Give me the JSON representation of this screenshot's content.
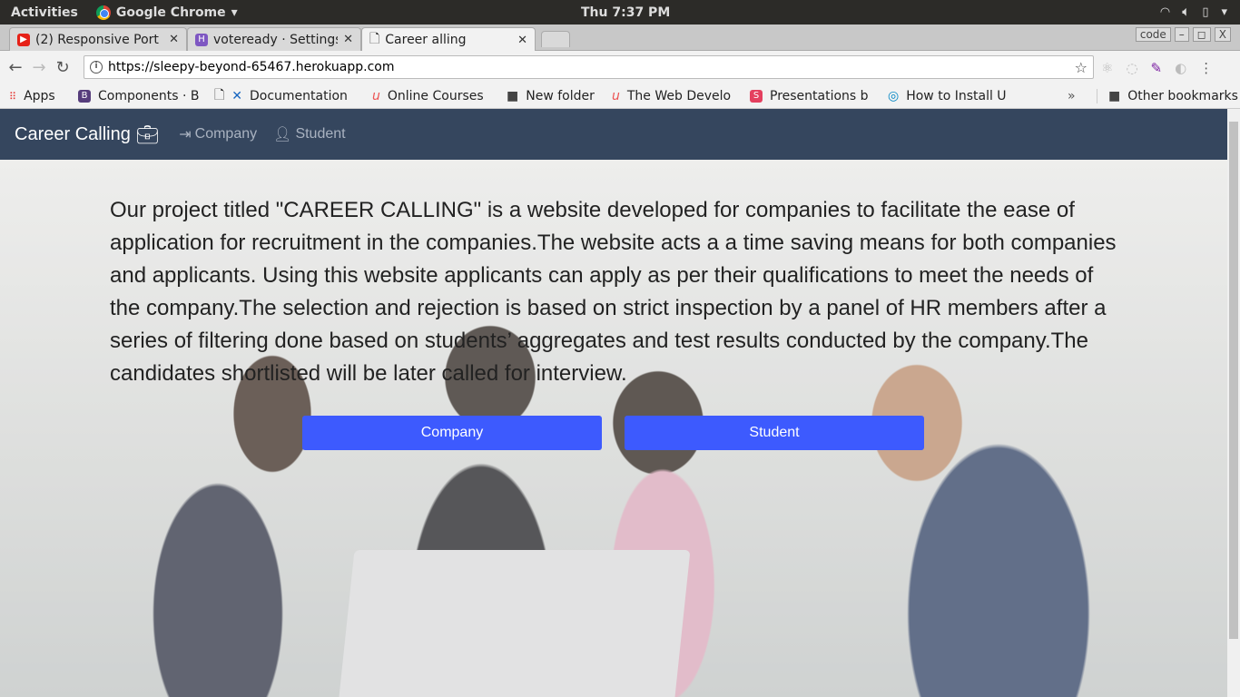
{
  "os": {
    "activities": "Activities",
    "app": "Google Chrome",
    "clock": "Thu  7:37 PM"
  },
  "tabs": [
    {
      "title": "(2) Responsive Port",
      "color": "#e62117"
    },
    {
      "title": "voteready · Settings",
      "color": "#7e57c2"
    },
    {
      "title": "Career alling",
      "color": "#ffffff"
    }
  ],
  "window": {
    "profile": "code",
    "min": "–",
    "max": "◻",
    "close": "X"
  },
  "url": "https://sleepy-beyond-65467.herokuapp.com",
  "bookmarks": [
    {
      "label": "Apps"
    },
    {
      "label": "Components · B"
    },
    {
      "label": "Documentation"
    },
    {
      "label": "Online Courses"
    },
    {
      "label": "New folder"
    },
    {
      "label": "The Web Develo"
    },
    {
      "label": "Presentations b"
    },
    {
      "label": "How to Install U"
    }
  ],
  "bookmarks_more": "»",
  "other_bookmarks": "Other bookmarks",
  "navbar": {
    "brand": "Career Calling",
    "links": [
      "Company",
      "Student"
    ]
  },
  "hero": {
    "description": "Our project titled \"CAREER CALLING\" is a website developed for companies to facilitate the ease of application for recruitment in the companies.The website acts a a time saving means for both companies and applicants. Using this website applicants can apply as per their qualifications to meet the needs of the company.The selection and rejection is based on strict inspection by a panel of HR members after a series of filtering done based on students’ aggregates and test results conducted by the company.The candidates shortlisted will be later called for interview.",
    "buttons": [
      "Company",
      "Student"
    ]
  },
  "colors": {
    "navbar": "#35465e",
    "button": "#3d5afe"
  }
}
